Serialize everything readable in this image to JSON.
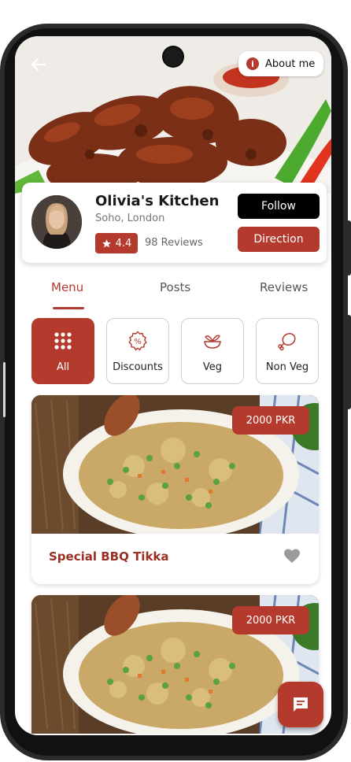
{
  "header": {
    "about_label": "About me",
    "info_glyph": "i"
  },
  "profile": {
    "name": "Olivia's Kitchen",
    "location": "Soho, London",
    "rating": "4.4",
    "reviews": "98 Reviews",
    "follow_label": "Follow",
    "direction_label": "Direction"
  },
  "tabs": [
    {
      "label": "Menu",
      "active": true
    },
    {
      "label": "Posts",
      "active": false
    },
    {
      "label": "Reviews",
      "active": false
    }
  ],
  "categories": [
    {
      "label": "All",
      "icon": "grid-icon",
      "active": true
    },
    {
      "label": "Discounts",
      "icon": "discount-icon",
      "active": false
    },
    {
      "label": "Veg",
      "icon": "veg-bowl-icon",
      "active": false
    },
    {
      "label": "Non Veg",
      "icon": "drumstick-icon",
      "active": false
    }
  ],
  "items": [
    {
      "title": "Special BBQ Tikka",
      "price": "2000 PKR"
    },
    {
      "title": "",
      "price": "2000 PKR"
    }
  ],
  "colors": {
    "accent": "#b43a2d",
    "black": "#000000"
  }
}
